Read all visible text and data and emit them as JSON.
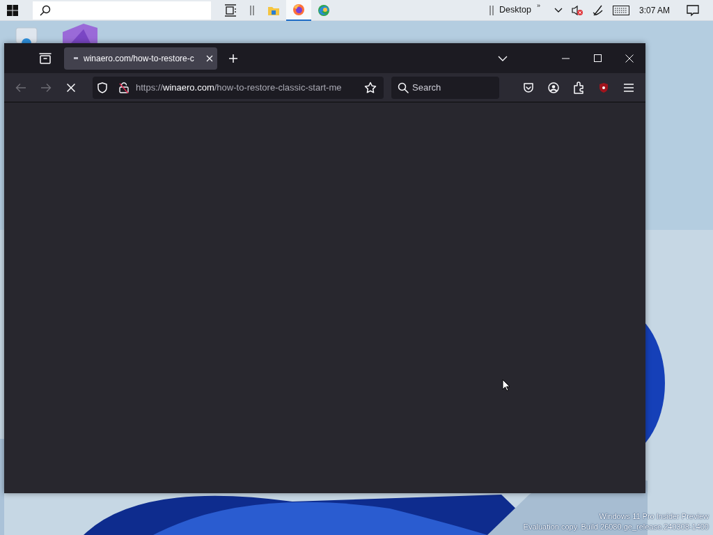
{
  "taskbar": {
    "apps": [
      {
        "kind": "taskview",
        "selected": false
      },
      {
        "kind": "explorer",
        "selected": false
      },
      {
        "kind": "firefox",
        "selected": true
      },
      {
        "kind": "edge",
        "selected": false
      }
    ],
    "toolbar_label": "Desktop",
    "overflow": "»",
    "clock": "3:07 AM",
    "muted": true
  },
  "browser": {
    "tabs": [
      {
        "title": "winaero.com/how-to-restore-c",
        "selected": true
      }
    ],
    "back_disabled": true,
    "forward_disabled": true,
    "loading": true,
    "address": {
      "scheme": "https://",
      "host": "winaero.com",
      "path": "/how-to-restore-classic-start-me"
    },
    "search": {
      "placeholder": "Search"
    }
  },
  "watermark": [
    "Windows 11 Pro Insider Preview",
    "Evaluation copy. Build 26080.ge_release.240308-1400"
  ]
}
